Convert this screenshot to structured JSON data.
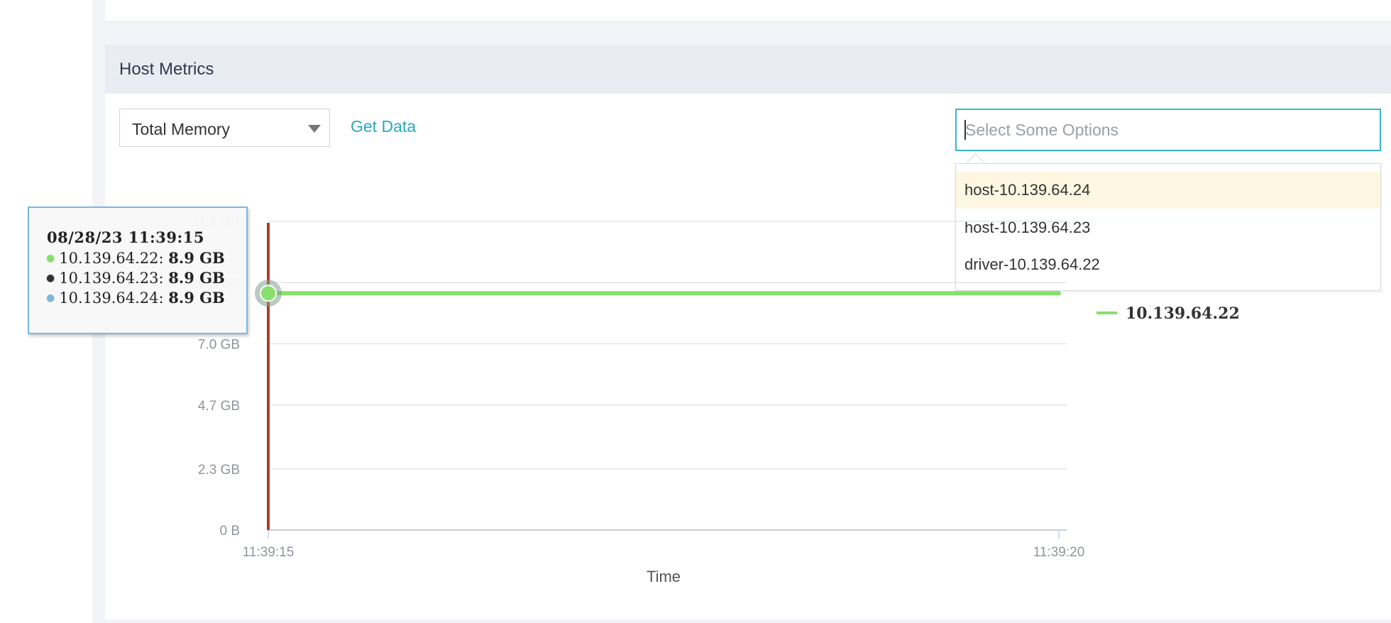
{
  "panel": {
    "title": "Host Metrics"
  },
  "controls": {
    "metric_select": {
      "value": "Total Memory"
    },
    "get_data_label": "Get Data",
    "host_select": {
      "placeholder": "Select Some Options",
      "options": [
        "host-10.139.64.24",
        "host-10.139.64.23",
        "driver-10.139.64.22"
      ],
      "highlighted_index": 0
    }
  },
  "colors": {
    "series_green": "#86e06c",
    "cursor_red": "#b23a2e",
    "accent_teal": "#29a7c2",
    "tooltip_black_dot": "#333333",
    "tooltip_blue_dot": "#7cb6e0"
  },
  "chart_data": {
    "type": "line",
    "xlabel": "Time",
    "ylabel": "",
    "x_ticks": [
      "11:39:15",
      "11:39:20"
    ],
    "y_ticks": [
      "0 B",
      "2.3 GB",
      "4.7 GB",
      "7.0 GB",
      "9.3 GB",
      "11.6 GB"
    ],
    "y_tick_values": [
      0,
      2.3,
      4.7,
      7.0,
      9.3,
      11.6
    ],
    "ylim": [
      0,
      11.6
    ],
    "xlim": [
      "11:39:15",
      "11:39:20"
    ],
    "grid": true,
    "legend_position": "right",
    "series": [
      {
        "name": "10.139.64.22",
        "x": [
          "11:39:15",
          "11:39:20"
        ],
        "values": [
          8.9,
          8.9
        ]
      }
    ],
    "tooltip": {
      "title": "08/28/23 11:39:15",
      "rows": [
        {
          "label": "10.139.64.22",
          "value": "8.9 GB",
          "dot_color": "#86e06c"
        },
        {
          "label": "10.139.64.23",
          "value": "8.9 GB",
          "dot_color": "#333333"
        },
        {
          "label": "10.139.64.24",
          "value": "8.9 GB",
          "dot_color": "#7cb6e0"
        }
      ]
    }
  }
}
